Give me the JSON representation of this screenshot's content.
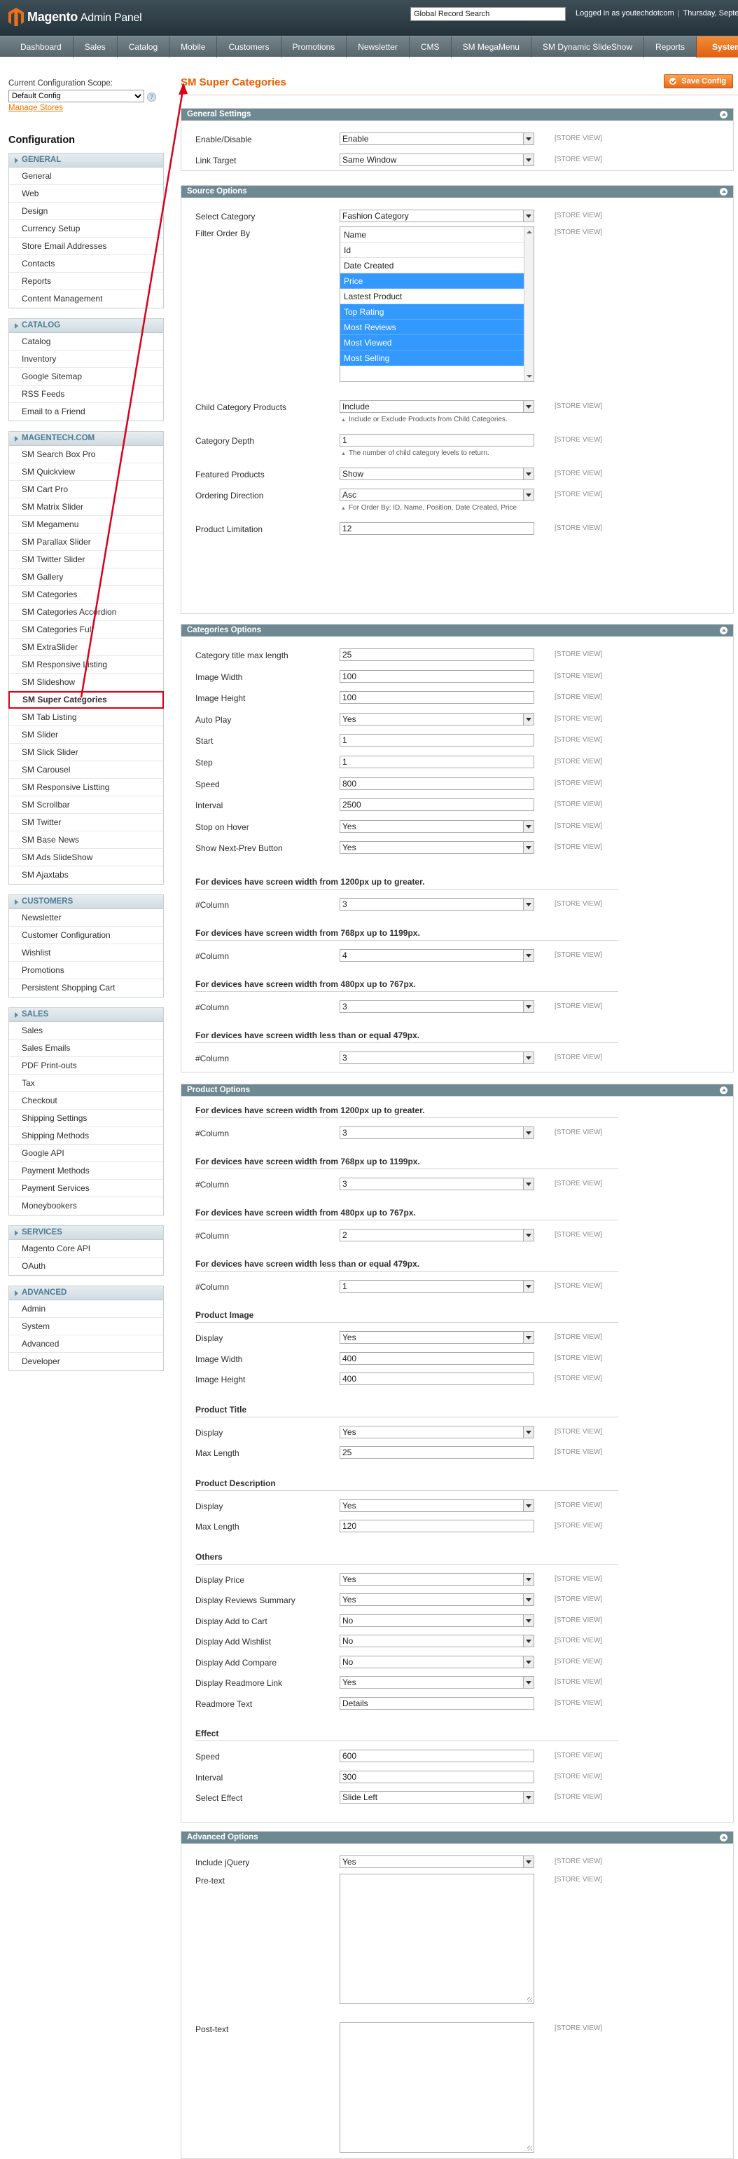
{
  "header": {
    "brand": "Magento",
    "brand_sub": "Admin Panel",
    "search_value": "Global Record Search",
    "logged_in": "Logged in as youtechdotcom",
    "date": "Thursday, Septe"
  },
  "nav": [
    "Dashboard",
    "Sales",
    "Catalog",
    "Mobile",
    "Customers",
    "Promotions",
    "Newsletter",
    "CMS",
    "SM MegaMenu",
    "SM Dynamic SlideShow",
    "Reports",
    "System"
  ],
  "scope": {
    "label": "Current Configuration Scope:",
    "value": "Default Config",
    "manage": "Manage Stores",
    "help": "?"
  },
  "sidebar": {
    "title": "Configuration",
    "groups": [
      {
        "title": "GENERAL",
        "items": [
          "General",
          "Web",
          "Design",
          "Currency Setup",
          "Store Email Addresses",
          "Contacts",
          "Reports",
          "Content Management"
        ]
      },
      {
        "title": "CATALOG",
        "items": [
          "Catalog",
          "Inventory",
          "Google Sitemap",
          "RSS Feeds",
          "Email to a Friend"
        ]
      },
      {
        "title": "MAGENTECH.COM",
        "items": [
          "SM Search Box Pro",
          "SM Quickview",
          "SM Cart Pro",
          "SM Matrix Slider",
          "SM Megamenu",
          "SM Parallax Slider",
          "SM Twitter Slider",
          "SM Gallery",
          "SM Categories",
          "SM Categories Accordion",
          "SM Categories Full",
          "SM ExtraSlider",
          "SM Responsive Listing",
          "SM Slideshow",
          "SM Super Categories",
          "SM Tab Listing",
          "SM Slider",
          "SM Slick Slider",
          "SM Carousel",
          "SM Responsive Listting",
          "SM Scrollbar",
          "SM Twitter",
          "SM Base News",
          "SM Ads SlideShow",
          "SM Ajaxtabs"
        ]
      },
      {
        "title": "CUSTOMERS",
        "items": [
          "Newsletter",
          "Customer Configuration",
          "Wishlist",
          "Promotions",
          "Persistent Shopping Cart"
        ]
      },
      {
        "title": "SALES",
        "items": [
          "Sales",
          "Sales Emails",
          "PDF Print-outs",
          "Tax",
          "Checkout",
          "Shipping Settings",
          "Shipping Methods",
          "Google API",
          "Payment Methods",
          "Payment Services",
          "Moneybookers"
        ]
      },
      {
        "title": "SERVICES",
        "items": [
          "Magento Core API",
          "OAuth"
        ]
      },
      {
        "title": "ADVANCED",
        "items": [
          "Admin",
          "System",
          "Advanced",
          "Developer"
        ]
      }
    ]
  },
  "page": {
    "title": "SM Super Categories",
    "save": "Save Config",
    "scope_tag": "[STORE VIEW]"
  },
  "general": {
    "title": "General Settings",
    "rows": [
      {
        "label": "Enable/Disable",
        "value": "Enable"
      },
      {
        "label": "Link Target",
        "value": "Same Window"
      }
    ]
  },
  "source": {
    "title": "Source Options",
    "select_category": {
      "label": "Select Category",
      "value": "Fashion Category"
    },
    "filter_order": {
      "label": "Filter Order By",
      "options": [
        {
          "t": "Name",
          "on": false
        },
        {
          "t": "Id",
          "on": false
        },
        {
          "t": "Date Created",
          "on": false
        },
        {
          "t": "Price",
          "on": true
        },
        {
          "t": "Lastest Product",
          "on": false
        },
        {
          "t": "Top Rating",
          "on": true
        },
        {
          "t": "Most Reviews",
          "on": true
        },
        {
          "t": "Most Viewed",
          "on": true
        },
        {
          "t": "Most Selling",
          "on": true
        }
      ]
    },
    "child": {
      "label": "Child Category Products",
      "value": "Include",
      "note": "Include or Exclude Products from Child Categories."
    },
    "depth": {
      "label": "Category Depth",
      "value": "1",
      "note": "The number of child category levels to return."
    },
    "featured": {
      "label": "Featured Products",
      "value": "Show"
    },
    "ordering": {
      "label": "Ordering Direction",
      "value": "Asc",
      "note": "For Order By: ID, Name, Position, Date Created, Price"
    },
    "limit": {
      "label": "Product Limitation",
      "value": "12"
    }
  },
  "categories": {
    "title": "Categories Options",
    "rows": [
      {
        "label": "Category title max length",
        "value": "25"
      },
      {
        "label": "Image Width",
        "value": "100"
      },
      {
        "label": "Image Height",
        "value": "100"
      },
      {
        "label": "Auto Play",
        "value": "Yes"
      },
      {
        "label": "Start",
        "value": "1"
      },
      {
        "label": "Step",
        "value": "1"
      },
      {
        "label": "Speed",
        "value": "800"
      },
      {
        "label": "Interval",
        "value": "2500"
      },
      {
        "label": "Stop on Hover",
        "value": "Yes"
      },
      {
        "label": "Show Next-Prev Button",
        "value": "Yes"
      }
    ],
    "devices": [
      {
        "head": "For devices have screen width from 1200px up to greater.",
        "label": "#Column",
        "value": "3"
      },
      {
        "head": "For devices have screen width from 768px up to 1199px.",
        "label": "#Column",
        "value": "4"
      },
      {
        "head": "For devices have screen width from 480px up to 767px.",
        "label": "#Column",
        "value": "3"
      },
      {
        "head": "For devices have screen width less than or equal 479px.",
        "label": "#Column",
        "value": "3"
      }
    ]
  },
  "product": {
    "title": "Product Options",
    "devices": [
      {
        "head": "For devices have screen width from 1200px up to greater.",
        "label": "#Column",
        "value": "3"
      },
      {
        "head": "For devices have screen width from 768px up to 1199px.",
        "label": "#Column",
        "value": "3"
      },
      {
        "head": "For devices have screen width from 480px up to 767px.",
        "label": "#Column",
        "value": "2"
      },
      {
        "head": "For devices have screen width less than or equal 479px.",
        "label": "#Column",
        "value": "1"
      }
    ],
    "image": {
      "head": "Product Image",
      "rows": [
        {
          "label": "Display",
          "value": "Yes"
        },
        {
          "label": "Image Width",
          "value": "400"
        },
        {
          "label": "Image Height",
          "value": "400"
        }
      ]
    },
    "ptitle": {
      "head": "Product Title",
      "rows": [
        {
          "label": "Display",
          "value": "Yes"
        },
        {
          "label": "Max Length",
          "value": "25"
        }
      ]
    },
    "desc": {
      "head": "Product Description",
      "rows": [
        {
          "label": "Display",
          "value": "Yes"
        },
        {
          "label": "Max Length",
          "value": "120"
        }
      ]
    },
    "others": {
      "head": "Others",
      "rows": [
        {
          "label": "Display Price",
          "value": "Yes"
        },
        {
          "label": "Display Reviews Summary",
          "value": "Yes"
        },
        {
          "label": "Display Add to Cart",
          "value": "No"
        },
        {
          "label": "Display Add Wishlist",
          "value": "No"
        },
        {
          "label": "Display Add Compare",
          "value": "No"
        },
        {
          "label": "Display Readmore Link",
          "value": "Yes"
        },
        {
          "label": "Readmore Text",
          "value": "Details"
        }
      ]
    },
    "effect": {
      "head": "Effect",
      "rows": [
        {
          "label": "Speed",
          "value": "600"
        },
        {
          "label": "Interval",
          "value": "300"
        },
        {
          "label": "Select Effect",
          "value": "Slide Left"
        }
      ]
    }
  },
  "advanced": {
    "title": "Advanced Options",
    "jquery": {
      "label": "Include jQuery",
      "value": "Yes"
    },
    "pre": {
      "label": "Pre-text"
    },
    "post": {
      "label": "Post-text"
    }
  },
  "colors": {
    "accent": "#eb5e00",
    "nav_active": "#e15f12",
    "section_head": "#6f8992",
    "highlight": "#3399ff",
    "annotation": "#d9001a"
  }
}
